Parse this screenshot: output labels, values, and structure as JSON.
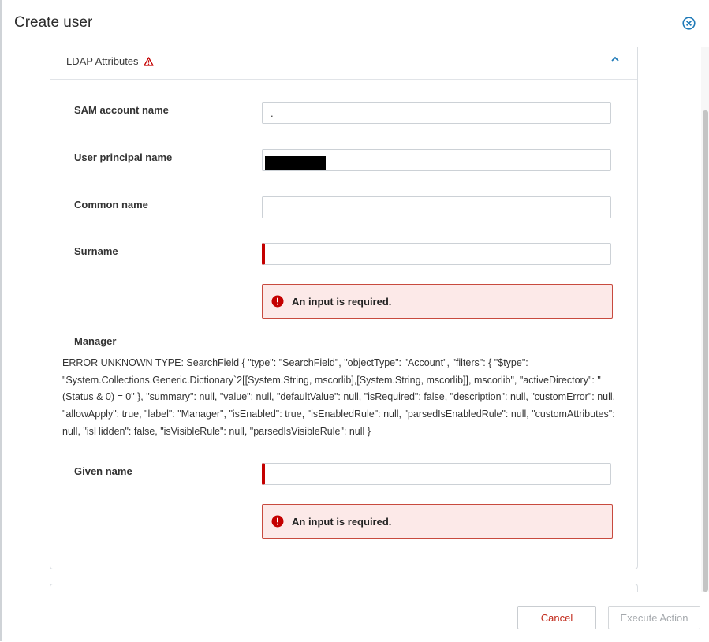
{
  "dialog": {
    "title": "Create user",
    "close_icon": "close-circle-icon"
  },
  "section": {
    "title": "LDAP Attributes",
    "warning_icon": "warning-triangle-icon",
    "collapse_icon": "chevron-up-icon",
    "colors": {
      "accent": "#1f7ab8",
      "error": "#c40000",
      "error_bg": "#fce9e8"
    }
  },
  "fields": {
    "sam": {
      "label": "SAM account name",
      "value": "."
    },
    "upn": {
      "label": "User principal name",
      "value": ""
    },
    "cn": {
      "label": "Common name",
      "value": ""
    },
    "surname": {
      "label": "Surname",
      "value": "",
      "error": "An input is required."
    },
    "manager": {
      "label": "Manager",
      "error_dump": "ERROR UNKNOWN TYPE: SearchField { \"type\": \"SearchField\", \"objectType\": \"Account\", \"filters\": { \"$type\": \"System.Collections.Generic.Dictionary`2[[System.String, mscorlib],[System.String, mscorlib]], mscorlib\", \"activeDirectory\": \"(Status & 0) = 0\" }, \"summary\": null, \"value\": null, \"defaultValue\": null, \"isRequired\": false, \"description\": null, \"customError\": null, \"allowApply\": true, \"label\": \"Manager\", \"isEnabled\": true, \"isEnabledRule\": null, \"parsedIsEnabledRule\": null, \"customAttributes\": null, \"isHidden\": false, \"isVisibleRule\": null, \"parsedIsVisibleRule\": null }"
    },
    "given": {
      "label": "Given name",
      "value": "",
      "error": "An input is required."
    }
  },
  "footer": {
    "cancel_label": "Cancel",
    "execute_label": "Execute Action"
  }
}
